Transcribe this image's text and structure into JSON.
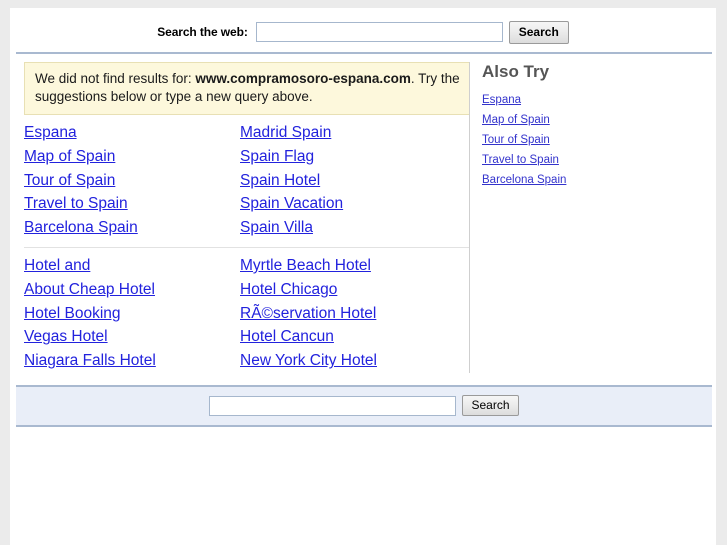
{
  "top_search": {
    "label": "Search the web:",
    "input_value": "",
    "input_placeholder": "",
    "button_label": "Search"
  },
  "notice": {
    "prefix": "We did not find results for: ",
    "query": "www.compramosoro-espana.com",
    "suffix": ". Try the suggestions below or type a new query above."
  },
  "also_try": {
    "title": "Also Try",
    "links": [
      "Espana",
      "Map of Spain",
      "Tour of Spain",
      "Travel to Spain",
      "Barcelona Spain"
    ]
  },
  "suggestion_groups": [
    {
      "left": [
        "Espana",
        "Map of Spain",
        "Tour of Spain",
        "Travel to Spain",
        "Barcelona Spain"
      ],
      "right": [
        "Madrid Spain",
        "Spain Flag",
        "Spain Hotel",
        "Spain Vacation",
        "Spain Villa"
      ]
    },
    {
      "left": [
        "Hotel and",
        "About Cheap Hotel",
        "Hotel Booking",
        "Vegas Hotel",
        "Niagara Falls Hotel"
      ],
      "right": [
        "Myrtle Beach Hotel",
        "Hotel Chicago",
        "RÃ©servation Hotel",
        "Hotel Cancun",
        "New York City Hotel"
      ]
    }
  ],
  "bottom_search": {
    "input_value": "",
    "input_placeholder": "",
    "button_label": "Search"
  },
  "colors": {
    "link": "#2222dd",
    "side_link": "#3333cc",
    "notice_bg": "#fdf8dc",
    "notice_border": "#e8e0b4",
    "rule": "#a9b9d0",
    "band_bg": "#e9eef8",
    "heading": "#555555",
    "page_bg": "#ebebeb"
  }
}
